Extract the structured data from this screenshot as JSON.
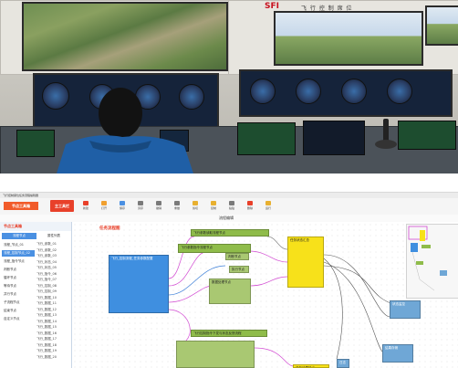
{
  "photo": {
    "sign_text": "飞 行 控 制 席 位",
    "logo_text": "SFI"
  },
  "app": {
    "window_title": "飞行控制席位任务流程编辑器",
    "toolbar": {
      "app_logo": "节点工具箱",
      "brand_button": "主工具栏",
      "tools": [
        {
          "label": "新建",
          "icon": "new-icon",
          "color": "#e8402a"
        },
        {
          "label": "打开",
          "icon": "open-icon",
          "color": "#f0a030"
        },
        {
          "label": "保存",
          "icon": "save-icon",
          "color": "#4a90e2"
        },
        {
          "label": "另存",
          "icon": "saveas-icon",
          "color": "#7a7a7a"
        },
        {
          "label": "撤销",
          "icon": "undo-icon",
          "color": "#7a7a7a"
        },
        {
          "label": "重做",
          "icon": "redo-icon",
          "color": "#7a7a7a"
        },
        {
          "label": "剪切",
          "icon": "cut-icon",
          "color": "#e8b030"
        },
        {
          "label": "复制",
          "icon": "copy-icon",
          "color": "#e8b030"
        },
        {
          "label": "粘贴",
          "icon": "paste-icon",
          "color": "#7a7a7a"
        },
        {
          "label": "删除",
          "icon": "delete-icon",
          "color": "#e8402a"
        },
        {
          "label": "运行",
          "icon": "run-icon",
          "color": "#e8b030"
        }
      ]
    },
    "subbar_title": "流程编辑",
    "sidebar": {
      "header": "节点工具箱",
      "tab_active": "流程节点",
      "tab_inactive": "属性列表",
      "items": [
        {
          "label": "流程_节点_01",
          "selected": false
        },
        {
          "label": "流程_控制节点_02",
          "selected": true
        },
        {
          "label": "流程_指令节点",
          "selected": false
        },
        {
          "label": "判断节点",
          "selected": false
        },
        {
          "label": "循环节点",
          "selected": false
        },
        {
          "label": "等待节点",
          "selected": false
        },
        {
          "label": "并行节点",
          "selected": false
        },
        {
          "label": "子流程节点",
          "selected": false
        },
        {
          "label": "结束节点",
          "selected": false
        },
        {
          "label": "自定义节点",
          "selected": false
        }
      ],
      "col2_items": [
        "飞行_参数_01",
        "飞行_参数_02",
        "飞行_参数_03",
        "飞行_状态_04",
        "飞行_状态_05",
        "飞行_指令_06",
        "飞行_指令_07",
        "飞行_控制_08",
        "飞行_控制_09",
        "飞行_数据_10",
        "飞行_数据_11",
        "飞行_数据_12",
        "飞行_数据_13",
        "飞行_数据_14",
        "飞行_数据_15",
        "飞行_数据_16",
        "飞行_数据_17",
        "飞行_数据_18",
        "飞行_数据_19",
        "飞行_数据_20"
      ]
    },
    "canvas": {
      "title": "任务流程图",
      "nodes": [
        {
          "name": "blue-source-node",
          "text": "飞行_控制流程_任务参数配置"
        },
        {
          "name": "green-node-1",
          "text": "飞行参数读取流程节点"
        },
        {
          "name": "green-node-2",
          "text": "飞行参数指令流程节点"
        },
        {
          "name": "green-node-3",
          "text": "判断节点"
        },
        {
          "name": "green-node-4",
          "text": "执行节点"
        },
        {
          "name": "green-node-5",
          "text": "数据处理节点"
        },
        {
          "name": "green-node-6",
          "text": "飞行控制指令下发与状态反馈流程"
        },
        {
          "name": "yellow-node-1",
          "text": "任务状态汇总"
        },
        {
          "name": "yellow-node-2",
          "text": "任务结果输出"
        },
        {
          "name": "steel-node-1",
          "text": "状态监控"
        },
        {
          "name": "steel-node-2",
          "text": "结果存储"
        },
        {
          "name": "steel-node-3",
          "text": "日志"
        }
      ]
    }
  }
}
